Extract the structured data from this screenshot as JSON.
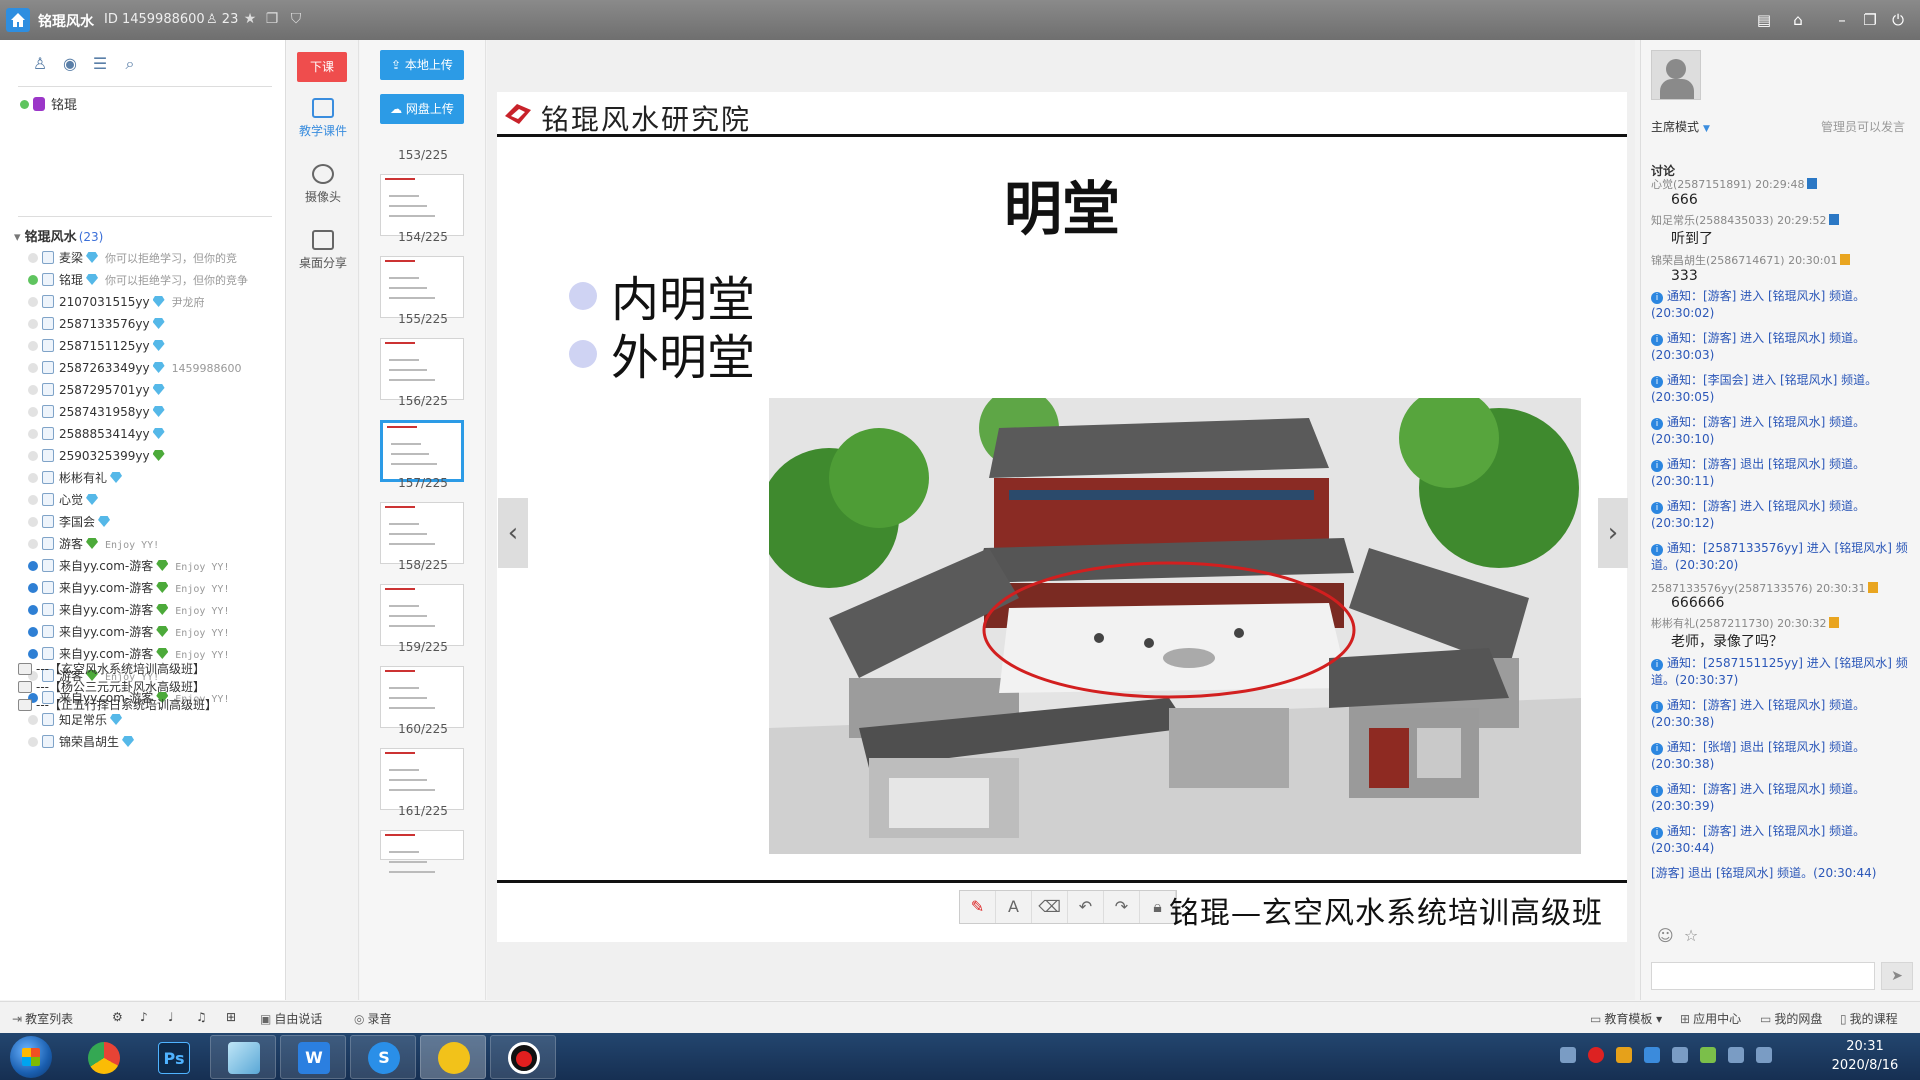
{
  "titlebar": {
    "app_name": "铭琨风水",
    "channel_id": "ID 1459988600",
    "online_count": "23"
  },
  "left": {
    "root_user": "铭琨",
    "channel_name": "铭琨风水",
    "channel_count": "(23)",
    "members": [
      {
        "name": "麦梁",
        "sig": "你可以拒绝学习，但你的竞",
        "status": "away",
        "gem": "blue",
        "mono": false
      },
      {
        "name": "铭琨",
        "sig": "你可以拒绝学习，但你的竞争",
        "status": "online",
        "gem": "blue",
        "mono": false
      },
      {
        "name": "2107031515yy",
        "sig": "尹龙府",
        "status": "away",
        "gem": "blue",
        "mono": false
      },
      {
        "name": "2587133576yy",
        "sig": "",
        "status": "away",
        "gem": "blue",
        "mono": false
      },
      {
        "name": "2587151125yy",
        "sig": "",
        "status": "away",
        "gem": "blue",
        "mono": false
      },
      {
        "name": "2587263349yy",
        "sig": "1459988600",
        "status": "away",
        "gem": "blue",
        "mono": false
      },
      {
        "name": "2587295701yy",
        "sig": "",
        "status": "away",
        "gem": "blue",
        "mono": false
      },
      {
        "name": "2587431958yy",
        "sig": "",
        "status": "away",
        "gem": "blue",
        "mono": false
      },
      {
        "name": "2588853414yy",
        "sig": "",
        "status": "away",
        "gem": "blue",
        "mono": false
      },
      {
        "name": "2590325399yy",
        "sig": "",
        "status": "away",
        "gem": "green",
        "mono": false
      },
      {
        "name": "彬彬有礼",
        "sig": "",
        "status": "away",
        "gem": "blue",
        "mono": false
      },
      {
        "name": "心觉",
        "sig": "",
        "status": "away",
        "gem": "blue",
        "mono": false
      },
      {
        "name": "李国会",
        "sig": "",
        "status": "away",
        "gem": "blue",
        "mono": false
      },
      {
        "name": "游客",
        "sig": "Enjoy YY!",
        "status": "away",
        "gem": "green",
        "mono": true
      },
      {
        "name": "来自yy.com-游客",
        "sig": "Enjoy YY!",
        "status": "blue",
        "gem": "green",
        "mono": true
      },
      {
        "name": "来自yy.com-游客",
        "sig": "Enjoy YY!",
        "status": "blue",
        "gem": "green",
        "mono": true
      },
      {
        "name": "来自yy.com-游客",
        "sig": "Enjoy YY!",
        "status": "blue",
        "gem": "green",
        "mono": true
      },
      {
        "name": "来自yy.com-游客",
        "sig": "Enjoy YY!",
        "status": "blue",
        "gem": "green",
        "mono": true
      },
      {
        "name": "来自yy.com-游客",
        "sig": "Enjoy YY!",
        "status": "blue",
        "gem": "green",
        "mono": true
      },
      {
        "name": "游客",
        "sig": "Enjoy YY!",
        "status": "away",
        "gem": "green",
        "mono": true
      },
      {
        "name": "来自yy.com-游客",
        "sig": "Enjoy YY!",
        "status": "blue",
        "gem": "green",
        "mono": true
      },
      {
        "name": "知足常乐",
        "sig": "",
        "status": "away",
        "gem": "blue",
        "mono": false
      },
      {
        "name": "锦荣昌胡生",
        "sig": "",
        "status": "away",
        "gem": "blue",
        "mono": false
      }
    ],
    "groups": [
      "---【玄空风水系统培训高级班】",
      "---【杨公三元元卦风水高级班】",
      "---【正五行择日系统培训高级班】"
    ]
  },
  "toolcol": {
    "end_class": "下课",
    "tools": [
      "教学课件",
      "摄像头",
      "桌面分享"
    ]
  },
  "thumbs": {
    "local_upload": "本地上传",
    "cloud_upload": "网盘上传",
    "pages": [
      "153/225",
      "154/225",
      "155/225",
      "156/225",
      "157/225",
      "158/225",
      "159/225",
      "160/225",
      "161/225"
    ],
    "selected_index": 3
  },
  "slide": {
    "institute": "铭琨风水研究院",
    "title": "明堂",
    "bullets": [
      "内明堂",
      "外明堂"
    ],
    "footer": "铭琨—玄空风水系统培训高级班"
  },
  "right": {
    "mode": "主席模式",
    "mode_hint": "管理员可以发言",
    "discuss": "讨论",
    "messages": [
      {
        "type": "chat",
        "meta": "心觉(2587151891) 20:29:48",
        "body": "666",
        "badge": "blue"
      },
      {
        "type": "chat",
        "meta": "知足常乐(2588435033) 20:29:52",
        "body": "听到了",
        "badge": "blue"
      },
      {
        "type": "chat",
        "meta": "锦荣昌胡生(2586714671) 20:30:01",
        "body": "333",
        "badge": "gold"
      },
      {
        "type": "notice",
        "text": "通知：[游客] 进入 [铭琨风水] 频道。(20:30:02)"
      },
      {
        "type": "notice",
        "text": "通知：[游客] 进入 [铭琨风水] 频道。(20:30:03)"
      },
      {
        "type": "notice",
        "text": "通知：[李国会] 进入 [铭琨风水] 频道。(20:30:05)"
      },
      {
        "type": "notice",
        "text": "通知：[游客] 进入 [铭琨风水] 频道。(20:30:10)"
      },
      {
        "type": "notice",
        "text": "通知：[游客] 退出 [铭琨风水] 频道。(20:30:11)"
      },
      {
        "type": "notice",
        "text": "通知：[游客] 进入 [铭琨风水] 频道。(20:30:12)"
      },
      {
        "type": "notice",
        "text": "通知：[2587133576yy] 进入 [铭琨风水] 频道。(20:30:20)"
      },
      {
        "type": "chat",
        "meta": "2587133576yy(2587133576) 20:30:31",
        "body": "666666",
        "badge": "gold"
      },
      {
        "type": "chat",
        "meta": "彬彬有礼(2587211730) 20:30:32",
        "body": "老师，录像了吗？",
        "badge": "gold"
      },
      {
        "type": "notice",
        "text": "通知：[2587151125yy] 进入 [铭琨风水] 频道。(20:30:37)"
      },
      {
        "type": "notice",
        "text": "通知：[游客] 进入 [铭琨风水] 频道。(20:30:38)"
      },
      {
        "type": "notice",
        "text": "通知：[张增] 退出 [铭琨风水] 频道。(20:30:38)"
      },
      {
        "type": "notice",
        "text": "通知：[游客] 进入 [铭琨风水] 频道。(20:30:39)"
      },
      {
        "type": "notice",
        "text": "通知：[游客] 进入 [铭琨风水] 频道。(20:30:44)"
      },
      {
        "type": "plain",
        "text": "[游客] 退出 [铭琨风水] 频道。(20:30:44)"
      }
    ]
  },
  "bottom": {
    "classroom_list": "教室列表",
    "free_talk": "自由说话",
    "record": "录音",
    "edu_template": "教育模板",
    "app_center": "应用中心",
    "my_disk": "我的网盘",
    "my_course": "我的课程"
  },
  "taskbar": {
    "time": "20:31",
    "date": "2020/8/16"
  }
}
